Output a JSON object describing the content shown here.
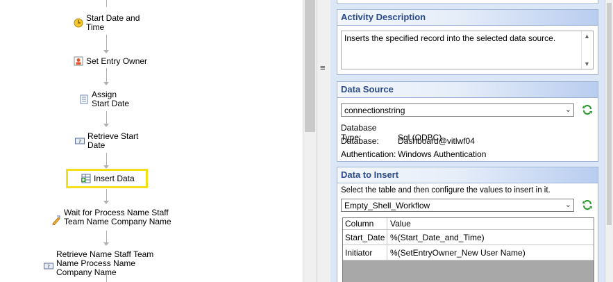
{
  "workflow": {
    "nodes": [
      {
        "label": "Start Date and Time",
        "icon": "clock-icon"
      },
      {
        "label": "Set Entry Owner",
        "icon": "user-card-icon"
      },
      {
        "label": "Assign Start Date",
        "icon": "document-icon"
      },
      {
        "label": "Retrieve Start Date",
        "icon": "retrieve-data-icon"
      },
      {
        "label": "Insert Data",
        "icon": "insert-data-icon"
      },
      {
        "label": "Wait for Process Name Staff Team Name Company Name",
        "icon": "pen-icon"
      },
      {
        "label": "Retrieve Name Staff Team Name Process Name Company Name",
        "icon": "retrieve-data-icon"
      }
    ],
    "selected": "Insert Data"
  },
  "splitter": {
    "grip": "≡"
  },
  "activity_description": {
    "title": "Activity Description",
    "text": "Inserts the specified record into the selected data source."
  },
  "data_source": {
    "title": "Data Source",
    "connection": "connectionstring",
    "fields": [
      {
        "label": "Database Type:",
        "value": "Sql (ODBC)"
      },
      {
        "label": "Database:",
        "value": "Dashboard@vitlwf04"
      },
      {
        "label": "Authentication:",
        "value": "Windows Authentication"
      }
    ]
  },
  "data_to_insert": {
    "title": "Data to Insert",
    "instruction": "Select the table and then configure the values to insert in it.",
    "table": "Empty_Shell_Workflow",
    "columns": [
      "Column",
      "Value"
    ],
    "rows": [
      {
        "column": "Start_Date",
        "value": "%(Start_Date_and_Time)"
      },
      {
        "column": "Initiator",
        "value": "%(SetEntryOwner_New User Name)"
      }
    ]
  },
  "colors": {
    "highlight": "#f2e01d",
    "panel_header_text": "#2a4a8a",
    "refresh_green": "#2e9a2e"
  }
}
